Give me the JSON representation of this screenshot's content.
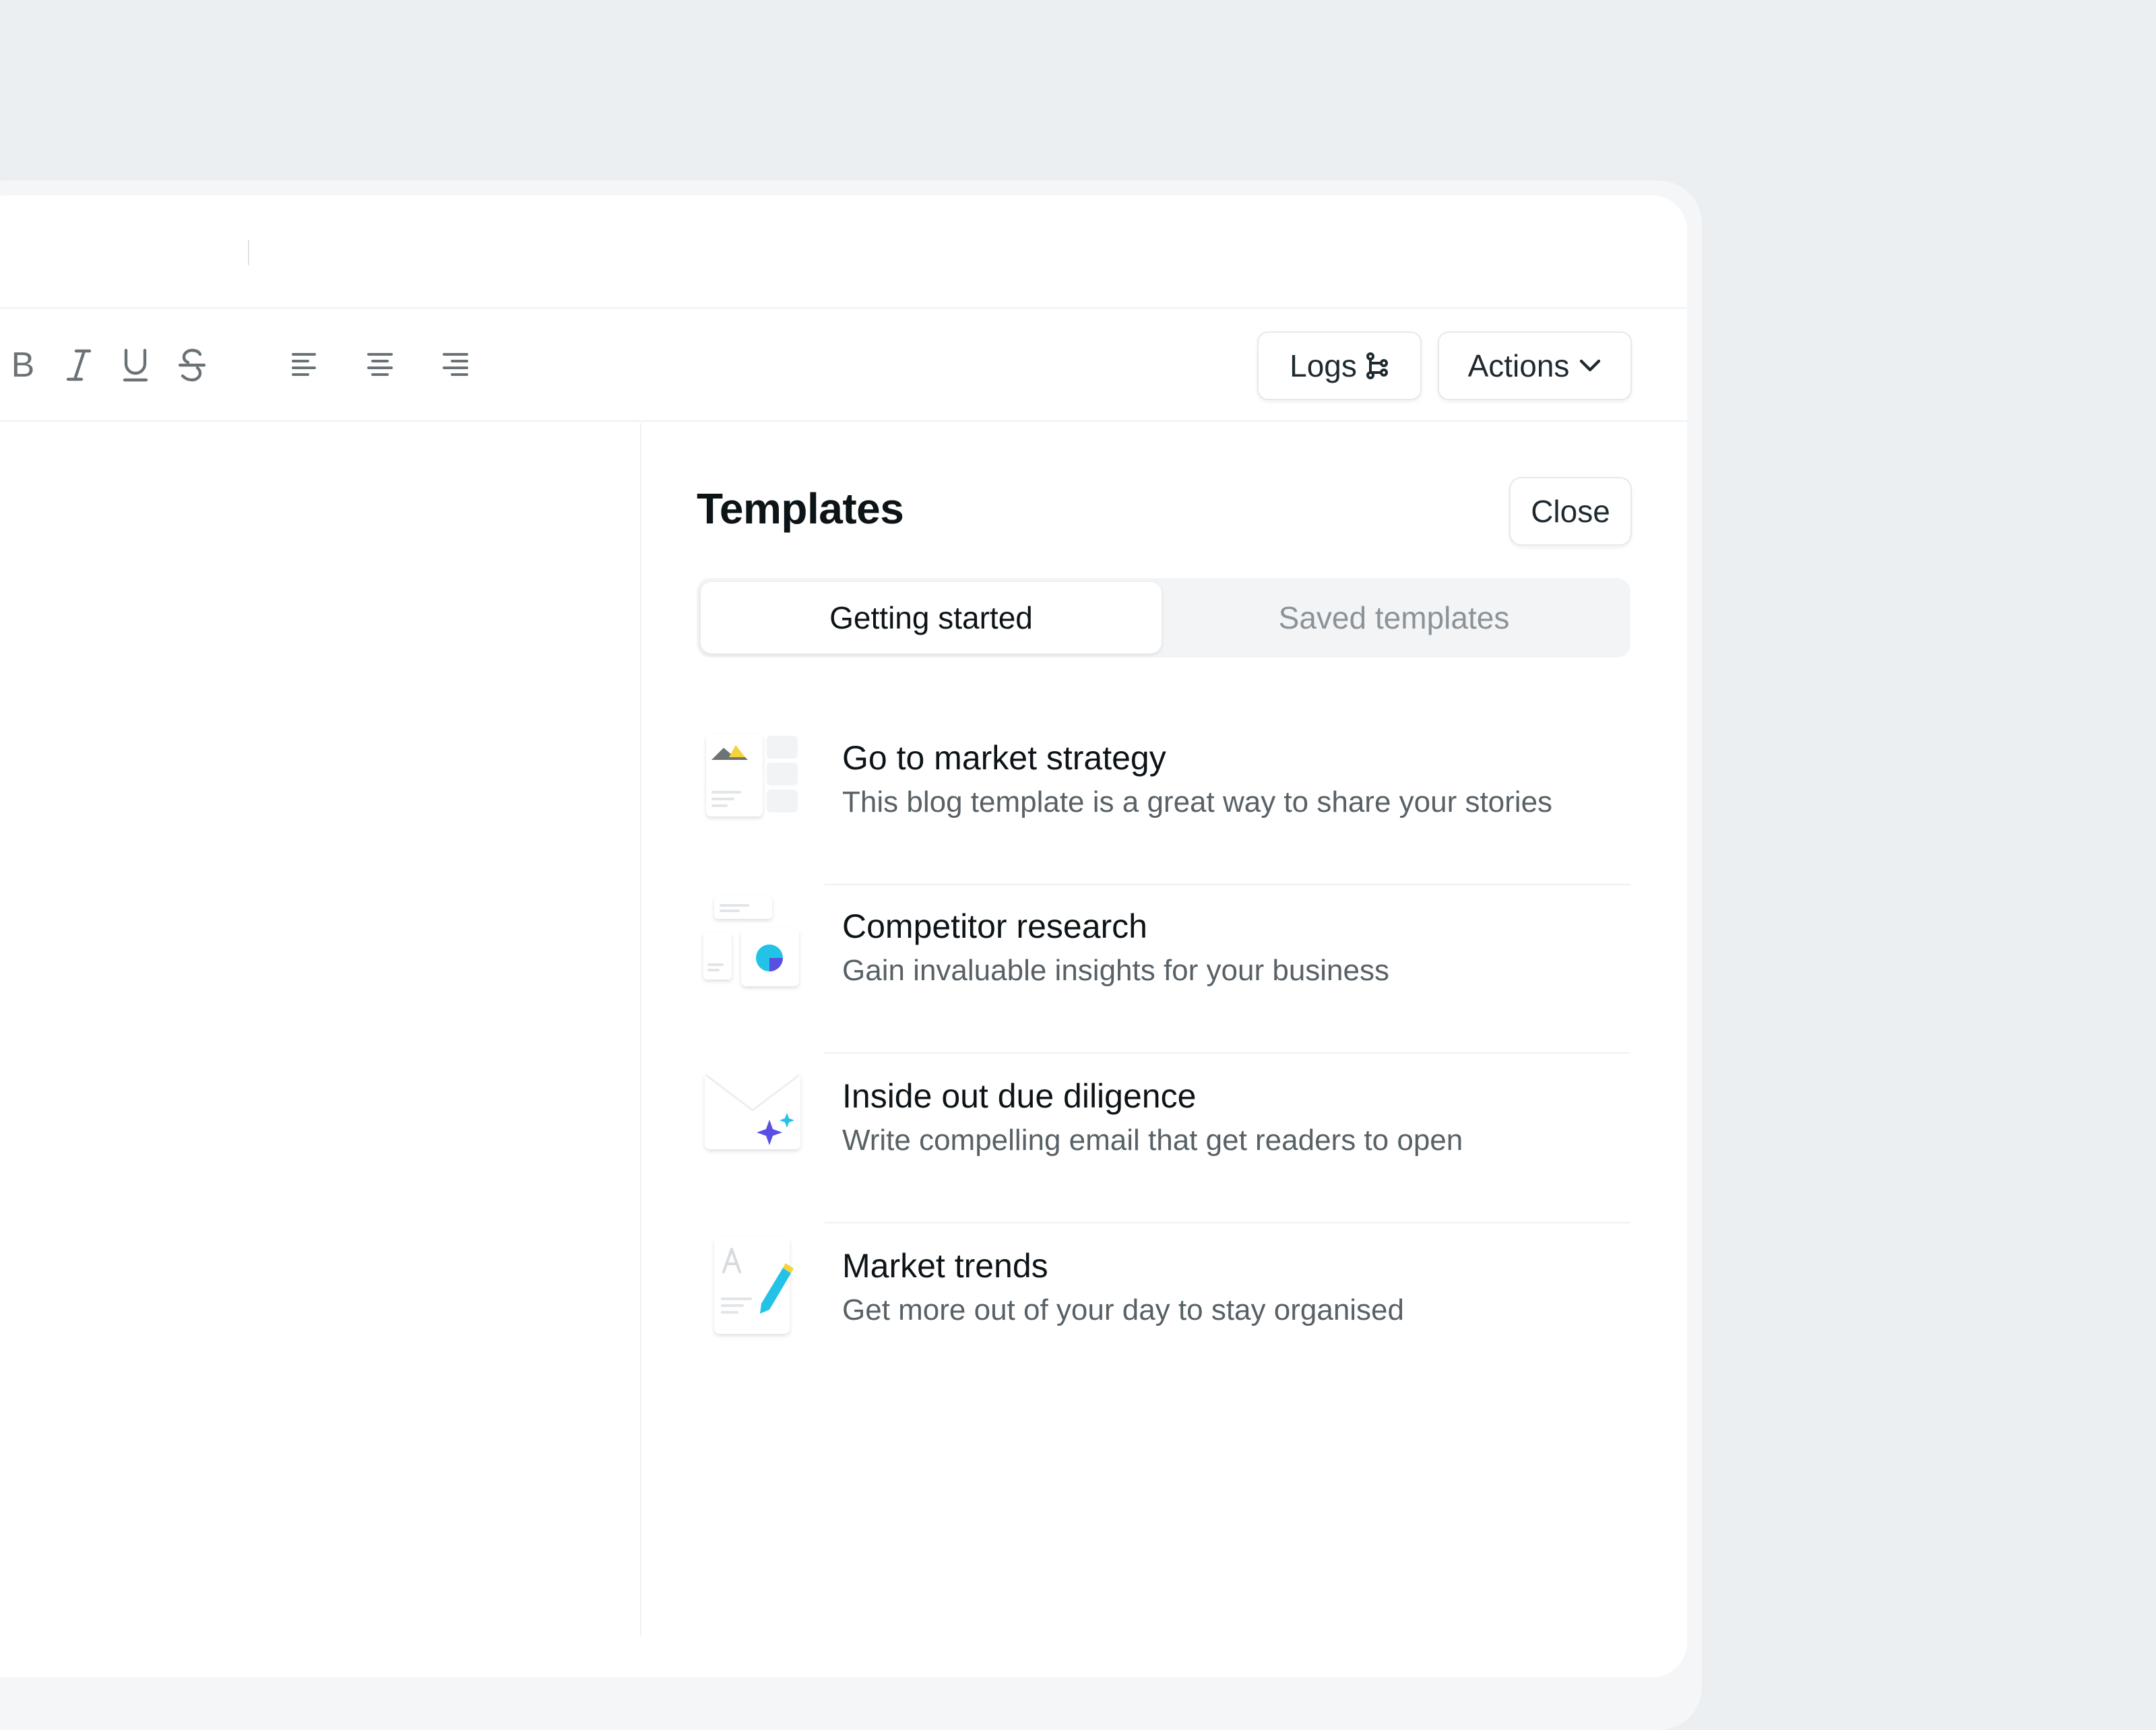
{
  "toolbar": {
    "format_icons": [
      "bold-icon",
      "italic-icon",
      "underline-icon",
      "strikethrough-icon",
      "align-left-icon",
      "align-center-icon",
      "align-right-icon"
    ],
    "format_labels": {
      "bold": "B"
    },
    "logs_label": "Logs",
    "actions_label": "Actions"
  },
  "panel": {
    "title": "Templates",
    "close_label": "Close",
    "tabs": [
      {
        "label": "Getting started",
        "active": true
      },
      {
        "label": "Saved templates",
        "active": false
      }
    ],
    "items": [
      {
        "title": "Go to market strategy",
        "description": "This blog template is a great way to share your stories",
        "icon": "blog-template-icon"
      },
      {
        "title": "Competitor research",
        "description": "Gain invaluable insights for your business",
        "icon": "research-chart-icon"
      },
      {
        "title": "Inside out due diligence",
        "description": "Write compelling email that get readers to open",
        "icon": "email-sparkle-icon"
      },
      {
        "title": "Market trends",
        "description": "Get more out of your day to stay organised",
        "icon": "document-pencil-icon"
      }
    ]
  },
  "colors": {
    "background": "#eceff2",
    "text_primary": "#0d1418",
    "text_secondary": "#586166",
    "accent_yellow": "#f6d23c",
    "accent_cyan": "#22c3e6",
    "accent_purple": "#5b4fe3"
  }
}
